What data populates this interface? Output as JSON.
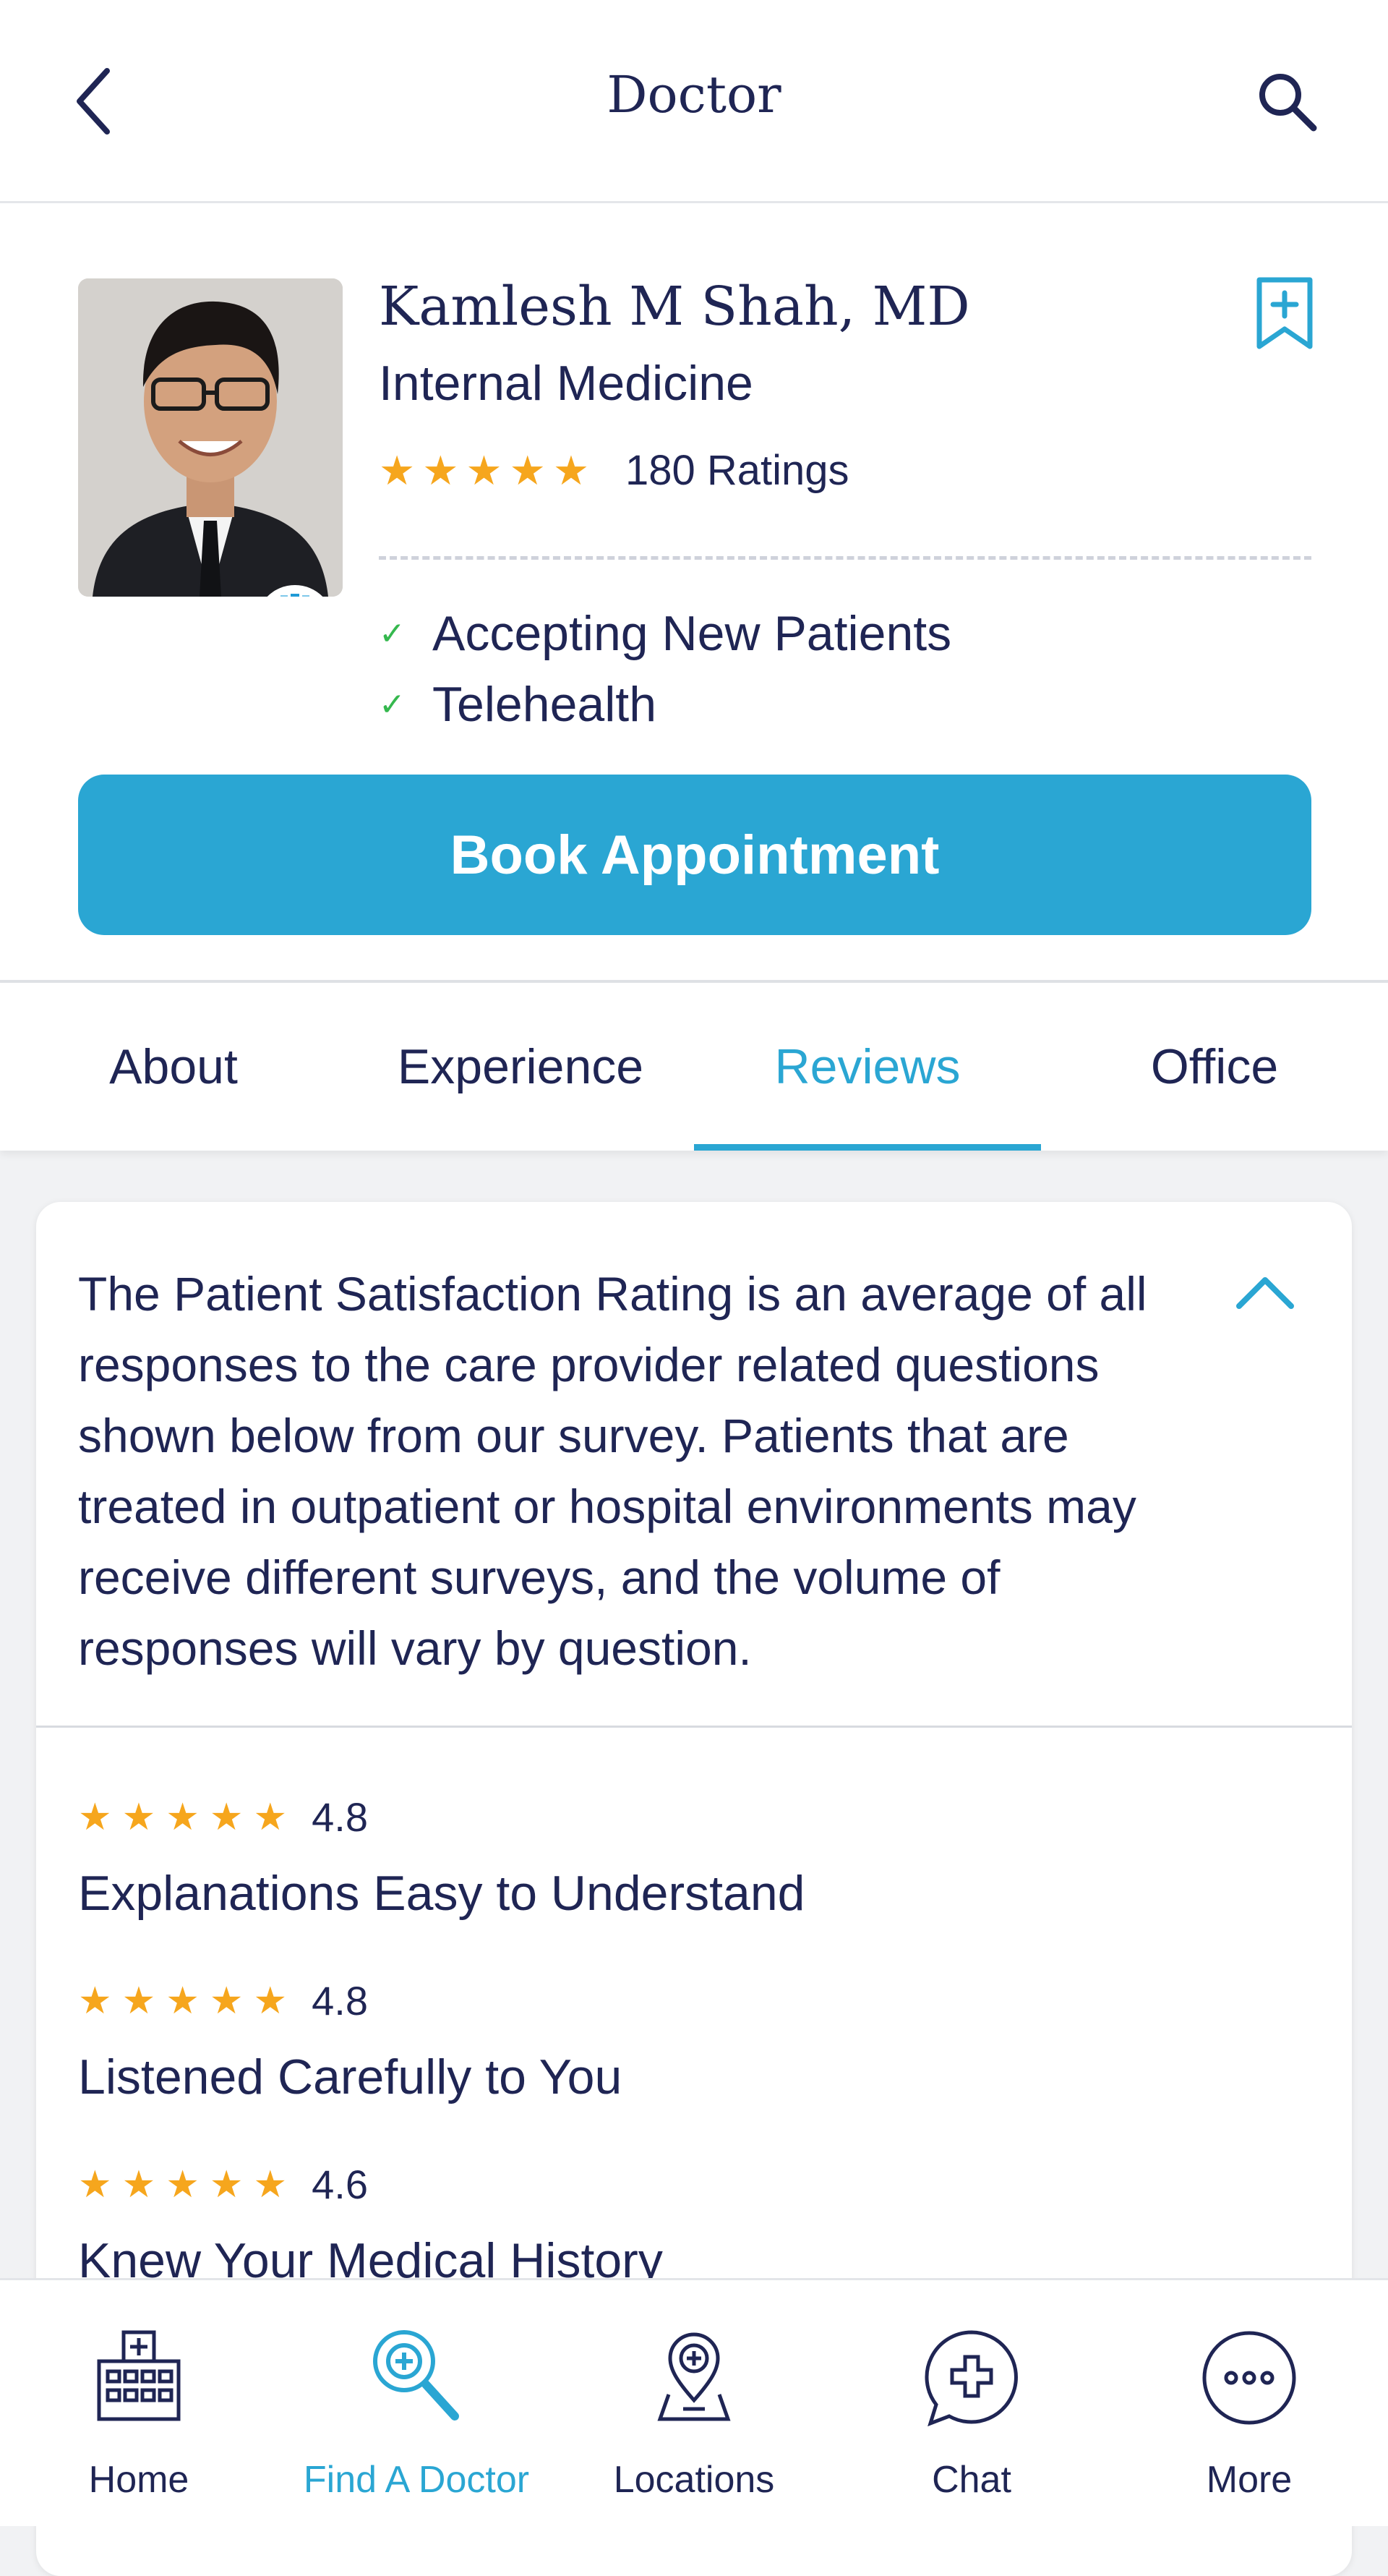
{
  "header": {
    "title": "Doctor",
    "back_icon": "chevron-left-icon",
    "search_icon": "search-icon"
  },
  "doctor": {
    "name": "Kamlesh M Shah, MD",
    "specialty": "Internal Medicine",
    "star_rating": 5,
    "ratings_count": "180 Ratings",
    "features": [
      "Accepting New Patients",
      "Telehealth"
    ],
    "book_button": "Book Appointment"
  },
  "tabs": [
    {
      "label": "About",
      "active": false
    },
    {
      "label": "Experience",
      "active": false
    },
    {
      "label": "Reviews",
      "active": true
    },
    {
      "label": "Office",
      "active": false
    }
  ],
  "reviews": {
    "info_text": "The Patient Satisfaction Rating is an average of all responses to the care provider related questions shown below from our survey. Patients that are treated in outpatient or hospital environments may receive different surveys, and the volume of responses will vary by question.",
    "items": [
      {
        "score": "4.8",
        "label": "Explanations Easy to Understand"
      },
      {
        "score": "4.8",
        "label": "Listened Carefully to You"
      },
      {
        "score": "4.6",
        "label": "Knew Your Medical History"
      }
    ]
  },
  "bottom_nav": [
    {
      "label": "Home",
      "icon": "hospital-icon",
      "active": false
    },
    {
      "label": "Find A Doctor",
      "icon": "find-doctor-icon",
      "active": true
    },
    {
      "label": "Locations",
      "icon": "location-pin-icon",
      "active": false
    },
    {
      "label": "Chat",
      "icon": "chat-icon",
      "active": false
    },
    {
      "label": "More",
      "icon": "more-icon",
      "active": false
    }
  ],
  "colors": {
    "accent": "#2aa6d3",
    "text": "#1f2554",
    "star": "#f6a61d",
    "check": "#35b84e"
  }
}
